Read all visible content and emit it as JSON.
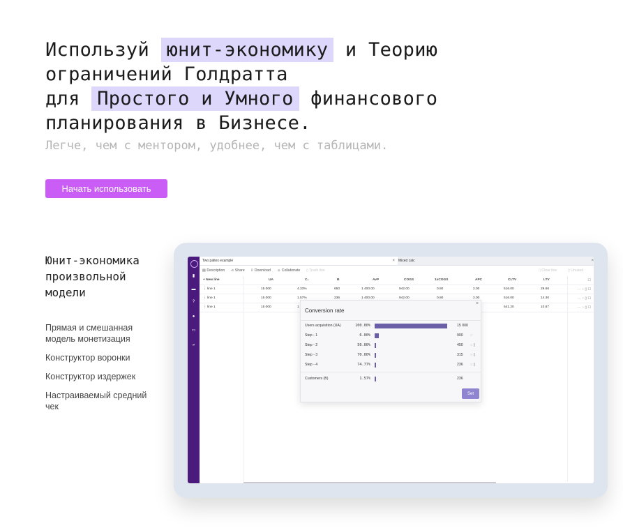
{
  "hero": {
    "line1_pre": "Используй ",
    "line1_hl": "юнит-экономику",
    "line1_post": " и Теорию",
    "line2": "ограничений Голдратта",
    "line3_pre": "для ",
    "line3_hl": "Простого и Умного",
    "line3_post": " финансового",
    "line4": "планирования в Бизнесе.",
    "subtitle": "Легче, чем с ментором, удобнее, чем с таблицами.",
    "cta": "Начать использовать"
  },
  "features": {
    "title": "Юнит-экономика произвольной модели",
    "items": [
      "Прямая и смешанная модель монетизация",
      "Конструктор воронки",
      "Конструктор издержек",
      "Настраиваемый средний чек"
    ]
  },
  "app": {
    "tabs": [
      {
        "label": "Two paltex example",
        "close": "×"
      },
      {
        "label": "Mixed calc",
        "close": "×"
      }
    ],
    "toolbar": {
      "description": "Description",
      "share": "Share",
      "download": "Download",
      "collaborate": "Collaborate",
      "trash": "Trash line",
      "clear": "Clear line",
      "unused": "Unused"
    },
    "grid": {
      "new_line": "+ New line",
      "columns": [
        "UA",
        "C₁",
        "B",
        "AvP",
        "COGS",
        "1xCOGS",
        "APC",
        "CLTV",
        "LTV"
      ],
      "rows": [
        {
          "name": "line 1",
          "cells": [
            "15 000",
            "4.33%",
            "650",
            "1 400.00",
            "942.00",
            "0.80",
            "2.00",
            "516.00",
            "29.66"
          ]
        },
        {
          "name": "line 1",
          "cells": [
            "15 000",
            "1.57%",
            "236",
            "1 400.00",
            "942.00",
            "0.80",
            "2.00",
            "516.00",
            "14.30"
          ]
        },
        {
          "name": "line 1",
          "cells": [
            "15 000",
            "1",
            "",
            "",
            "",
            "",
            "",
            "641.20",
            "10.87"
          ]
        }
      ],
      "row_actions": "⋯ ◌ ▯ ☐"
    },
    "modal": {
      "title": "Conversion rate",
      "close": "×",
      "rows": [
        {
          "label": "Users acquisition (UA)",
          "pct": "100.00%",
          "fraction": 1.0,
          "value": "15 000",
          "icons": ""
        },
        {
          "label": "Step - 1",
          "pct": "6.00%",
          "fraction": 0.06,
          "value": "900",
          "icons": "◌"
        },
        {
          "label": "Step - 2",
          "pct": "50.00%",
          "fraction": 0.015,
          "value": "450",
          "icons": "◌ ▯"
        },
        {
          "label": "Step - 3",
          "pct": "70.00%",
          "fraction": 0.01,
          "value": "315",
          "icons": "◌ ▯"
        },
        {
          "label": "Step - 4",
          "pct": "74.77%",
          "fraction": 0.008,
          "value": "236",
          "icons": "◌ ▯"
        }
      ],
      "summary": {
        "label": "Customers (B)",
        "pct": "1.57%",
        "fraction": 0.008,
        "value": "236"
      },
      "set_label": "Set"
    }
  },
  "colors": {
    "accent": "#c95df5",
    "highlight": "#ddd7fb",
    "sidebar": "#4a1a7c",
    "bar": "#6b5ea8"
  }
}
